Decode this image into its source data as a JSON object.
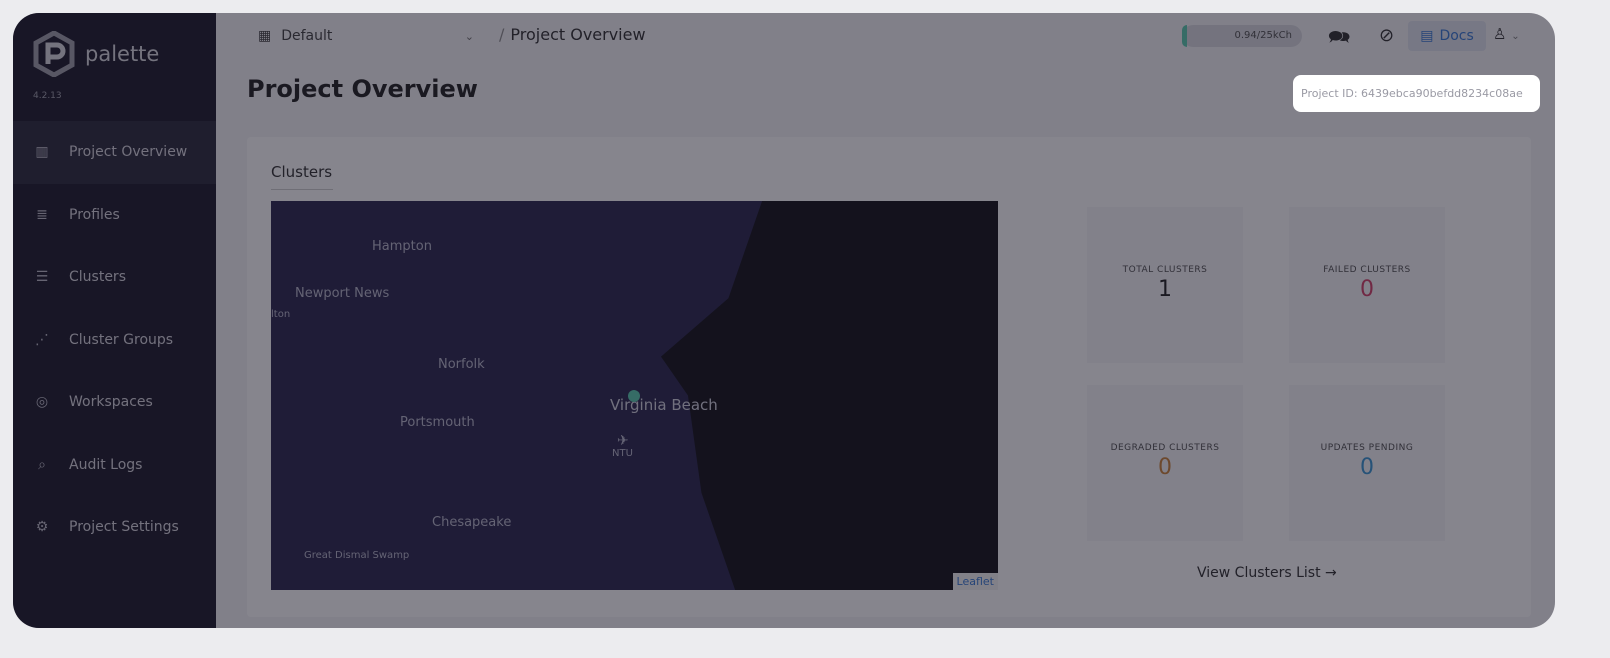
{
  "app": {
    "name": "palette",
    "version": "4.2.13"
  },
  "sidebar": {
    "items": [
      {
        "label": "Project Overview",
        "icon": "chart-icon",
        "active": true
      },
      {
        "label": "Profiles",
        "icon": "database-icon"
      },
      {
        "label": "Clusters",
        "icon": "clusters-icon"
      },
      {
        "label": "Cluster Groups",
        "icon": "network-icon"
      },
      {
        "label": "Workspaces",
        "icon": "target-icon"
      },
      {
        "label": "Audit Logs",
        "icon": "search-doc-icon"
      },
      {
        "label": "Project Settings",
        "icon": "gear-icon"
      }
    ]
  },
  "topbar": {
    "project": "Default",
    "breadcrumb_sep": "/",
    "breadcrumb": "Project Overview",
    "credits": "0.94/25kCh",
    "credits_fraction": 3.76e-05,
    "docs": "Docs"
  },
  "page": {
    "title": "Project Overview",
    "project_id": "Project ID: 6439ebca90befdd8234c08ae"
  },
  "clusters": {
    "title": "Clusters",
    "map": {
      "labels": [
        "Hampton",
        "Newport News",
        "lton",
        "Norfolk",
        "Virginia Beach",
        "Portsmouth",
        "NTU",
        "Chesapeake",
        "Great Dismal Swamp"
      ],
      "attribution": "Leaflet"
    },
    "stats": [
      {
        "label": "TOTAL CLUSTERS",
        "value": "1",
        "color": "#111111"
      },
      {
        "label": "FAILED CLUSTERS",
        "value": "0",
        "color": "#d0345e"
      },
      {
        "label": "DEGRADED CLUSTERS",
        "value": "0",
        "color": "#c87a2a"
      },
      {
        "label": "UPDATES PENDING",
        "value": "0",
        "color": "#2a8fd0"
      }
    ],
    "view_list": "View Clusters List"
  }
}
